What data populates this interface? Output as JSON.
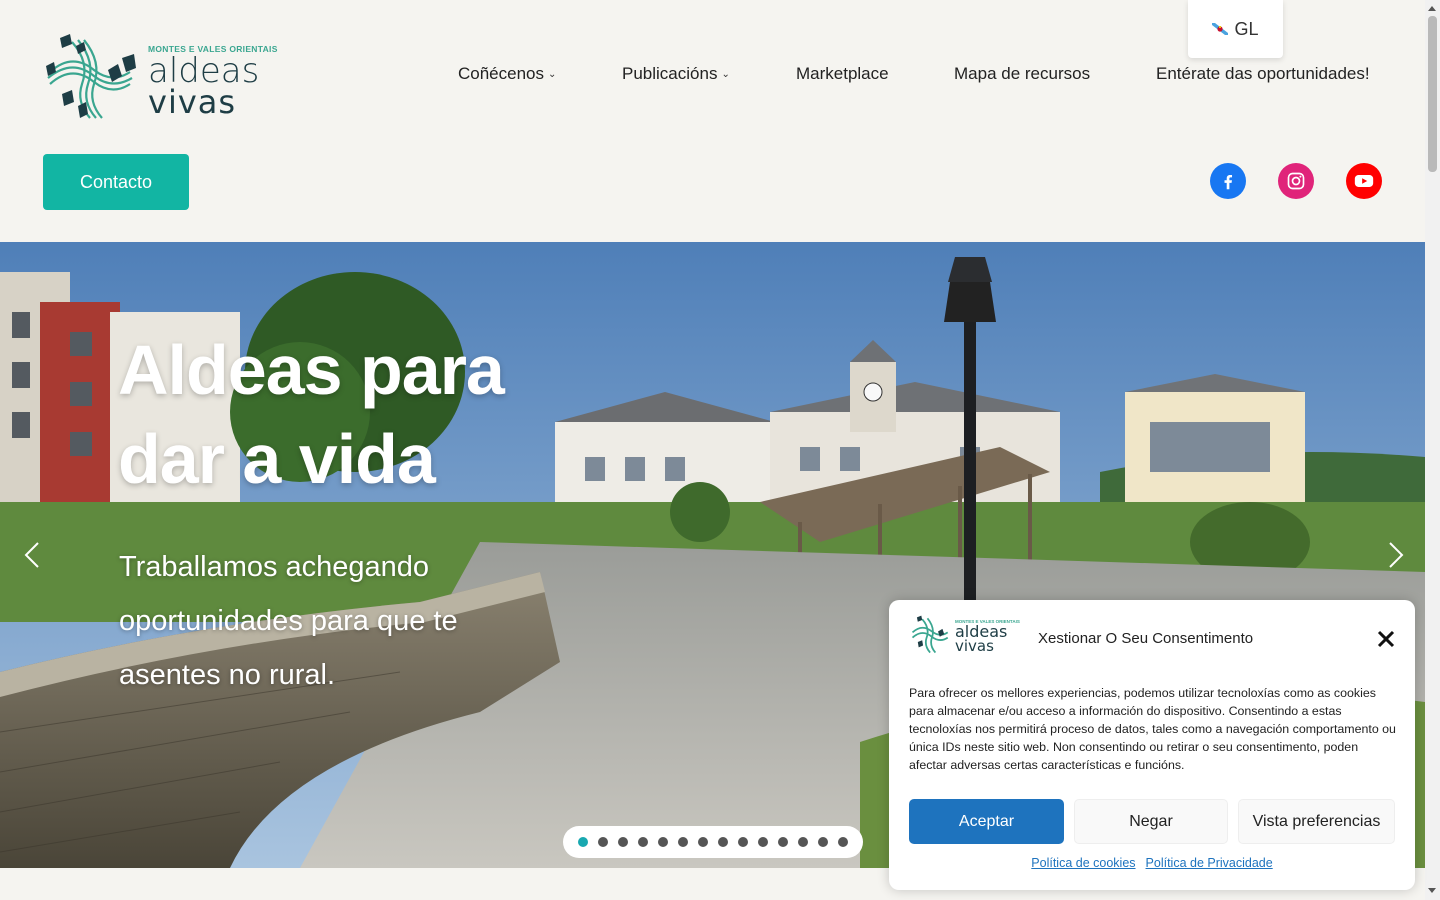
{
  "brand": {
    "tagline": "MONTES E VALES ORIENTAIS",
    "name_line1": "aldeas",
    "name_line2": "vivas",
    "colors": {
      "teal": "#3aa690",
      "dark": "#1e3d45",
      "accent": "#12b5a3"
    }
  },
  "language": {
    "code": "GL",
    "icon": "galician-flag-icon"
  },
  "nav": {
    "items": [
      {
        "label": "Coñécenos",
        "dropdown": true
      },
      {
        "label": "Publicacións",
        "dropdown": true
      },
      {
        "label": "Marketplace",
        "dropdown": false
      },
      {
        "label": "Mapa de recursos",
        "dropdown": false
      },
      {
        "label": "Entérate das oportunidades!",
        "dropdown": false
      }
    ]
  },
  "contact_button": {
    "label": "Contacto"
  },
  "social": [
    {
      "name": "facebook",
      "icon": "facebook-icon",
      "color": "#1877f2"
    },
    {
      "name": "instagram",
      "icon": "instagram-icon",
      "color": "#e0247a"
    },
    {
      "name": "youtube",
      "icon": "youtube-icon",
      "color": "#ff0000"
    }
  ],
  "hero": {
    "title": "Aldeas para dar a vida",
    "subtitle": "Traballamos achegando oportunidades para que te asentes no rural.",
    "slide_count": 14,
    "active_slide": 1,
    "prev_icon": "chevron-left-icon",
    "next_icon": "chevron-right-icon"
  },
  "cookie": {
    "title": "Xestionar O Seu Consentimento",
    "text": "Para ofrecer os mellores experiencias, podemos utilizar tecnoloxías como as cookies para almacenar e/ou acceso a información do dispositivo. Consentindo a estas tecnoloxías nos permitirá proceso de datos, tales como a navegación comportamento ou única IDs neste sitio web. Non consentindo ou retirar o seu consentimento, poden afectar adversas certas características e funcións.",
    "accept": "Aceptar",
    "deny": "Negar",
    "prefs": "Vista preferencias",
    "link_cookies": "Política de cookies",
    "link_privacy": "Política de Privacidade",
    "button_color": "#1e73be"
  }
}
